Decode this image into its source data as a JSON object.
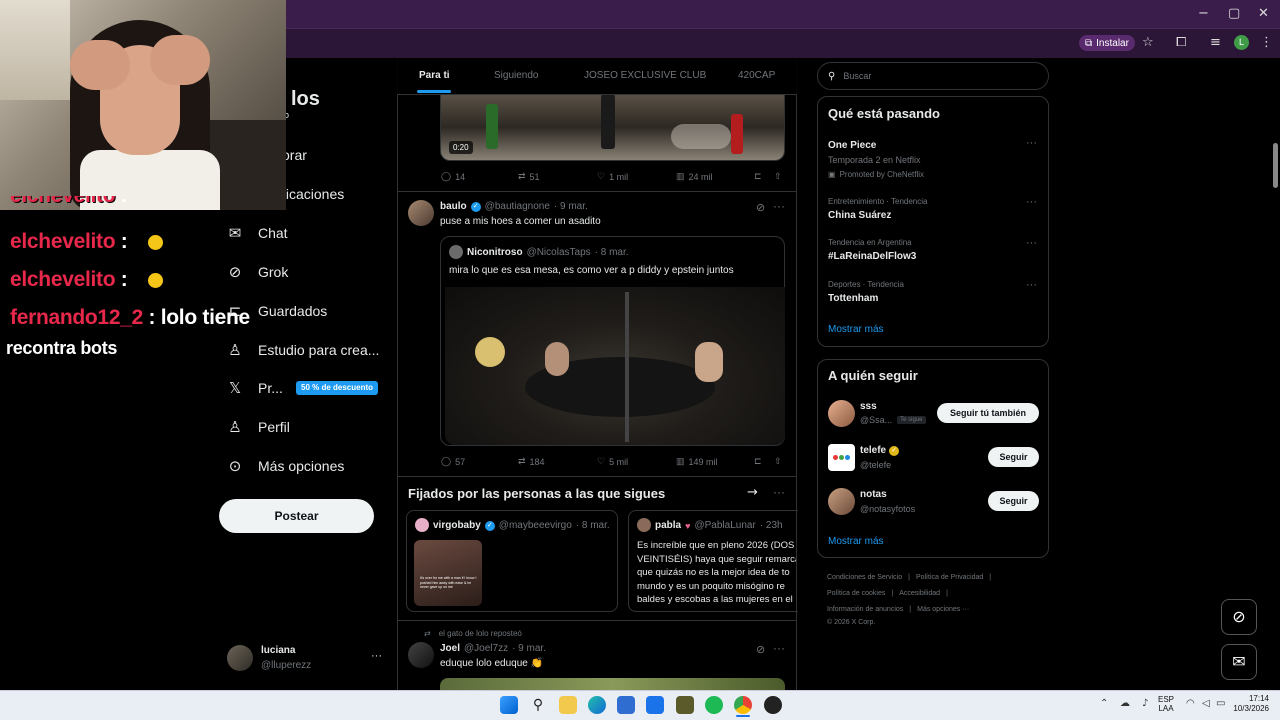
{
  "browser": {
    "install_label": "Instalar",
    "win_min": "−",
    "win_max": "▢",
    "win_close": "✕",
    "profile_initial": "L"
  },
  "chat": [
    {
      "user": "elchevelito",
      "colon": ":"
    },
    {
      "user": "elchevelito",
      "colon": ":"
    },
    {
      "user": "elchevelito",
      "colon": ":"
    },
    {
      "user": "fernando12_2",
      "colon": ":",
      "message": "lolo tiene"
    },
    {
      "continuation": "recontra bots"
    }
  ],
  "nav": {
    "partial_title": "los",
    "items": [
      {
        "label": "orar",
        "icon": "search-icon"
      },
      {
        "label": "ficaciones",
        "icon": "bell-icon"
      },
      {
        "label": "Chat",
        "icon": "mail-icon"
      },
      {
        "label": "Grok",
        "icon": "grok-icon"
      },
      {
        "label": "Guardados",
        "icon": "bookmark-icon"
      },
      {
        "label": "Estudio para crea...",
        "icon": "studio-icon"
      },
      {
        "label": "Pr...",
        "icon": "x-logo-icon"
      },
      {
        "label": "Perfil",
        "icon": "user-icon"
      },
      {
        "label": "Más opciones",
        "icon": "more-circle-icon"
      }
    ],
    "promo_badge": "50 % de descuento",
    "post_button": "Postear",
    "account": {
      "name": "luciana",
      "handle": "@lluperezz",
      "more": "···"
    }
  },
  "feed": {
    "tabs": [
      "Para ti",
      "Siguiendo",
      "JOSEO EXCLUSIVE CLUB",
      "420CAP"
    ],
    "top_post": {
      "video_time": "0:20",
      "replies": "14",
      "reposts": "51",
      "likes": "1 mil",
      "views": "24 mil"
    },
    "post": {
      "name": "baulo",
      "handle": "@bautiagnone",
      "time": "· 9 mar.",
      "text": "puse a mis hoes a comer un asadito",
      "quote": {
        "name": "Niconitroso",
        "handle": "@NicolasTaps",
        "time": "· 8 mar.",
        "text": "mira lo que es esa mesa, es como ver a p diddy y epstein juntos"
      },
      "replies": "57",
      "reposts": "184",
      "likes": "5 mil",
      "views": "149 mil"
    },
    "pinned": {
      "title": "Fijados por las personas a las que sigues",
      "cards": [
        {
          "name": "virgobaby",
          "handle": "@maybeeevirgo",
          "time": "· 8 mar.",
          "thumb_text": "it's over for me with a man if I know I pushed him away with ease & he never gave up on me"
        },
        {
          "name": "pabla",
          "handle": "@PablaLunar",
          "time": "· 23h",
          "lines": [
            "Es increíble que en pleno 2026 (DOS",
            "VEINTISÉIS) haya que seguir remarca",
            "que quizás no es la mejor idea de to",
            "mundo y es un poquito misógino re",
            "baldes y escobas a las mujeres en el"
          ]
        }
      ]
    },
    "repost": {
      "context": "el gato de lolo reposteó",
      "name": "Joel",
      "handle": "@Joel7zz",
      "time": "· 9 mar.",
      "text": "eduque lolo eduque 👏"
    }
  },
  "right": {
    "search_placeholder": "Buscar",
    "trends_title": "Qué está pasando",
    "trends": [
      {
        "name": "One Piece",
        "sub": "Temporada 2 en Netflix",
        "promo": "Promoted by CheNetflix"
      },
      {
        "context": "Entretenimiento · Tendencia",
        "name": "China Suárez"
      },
      {
        "context": "Tendencia en Argentina",
        "name": "#LaReinaDelFlow3"
      },
      {
        "context": "Deportes · Tendencia",
        "name": "Tottenham"
      }
    ],
    "show_more": "Mostrar más",
    "follow_title": "A quién seguir",
    "follow": [
      {
        "name": "sss",
        "handle": "@Ssa...",
        "badge": "Te sigue",
        "button": "Seguir tú también"
      },
      {
        "name": "telefe",
        "handle": "@telefe",
        "button": "Seguir"
      },
      {
        "name": "notas",
        "handle": "@notasyfotos",
        "button": "Seguir"
      }
    ],
    "footer": [
      "Condiciones de Servicio",
      "Política de Privacidad",
      "Política de cookies",
      "Accesibilidad",
      "Información de anuncios",
      "Más opciones ···",
      "© 2026 X Corp."
    ]
  },
  "taskbar": {
    "lang1": "ESP",
    "lang2": "LAA",
    "time": "17:14",
    "date": "10/3/2026"
  },
  "colors": {
    "accent": "#1d9bf0",
    "chat_user": "#e8284b",
    "browser_frame": "#3a1d4a"
  }
}
